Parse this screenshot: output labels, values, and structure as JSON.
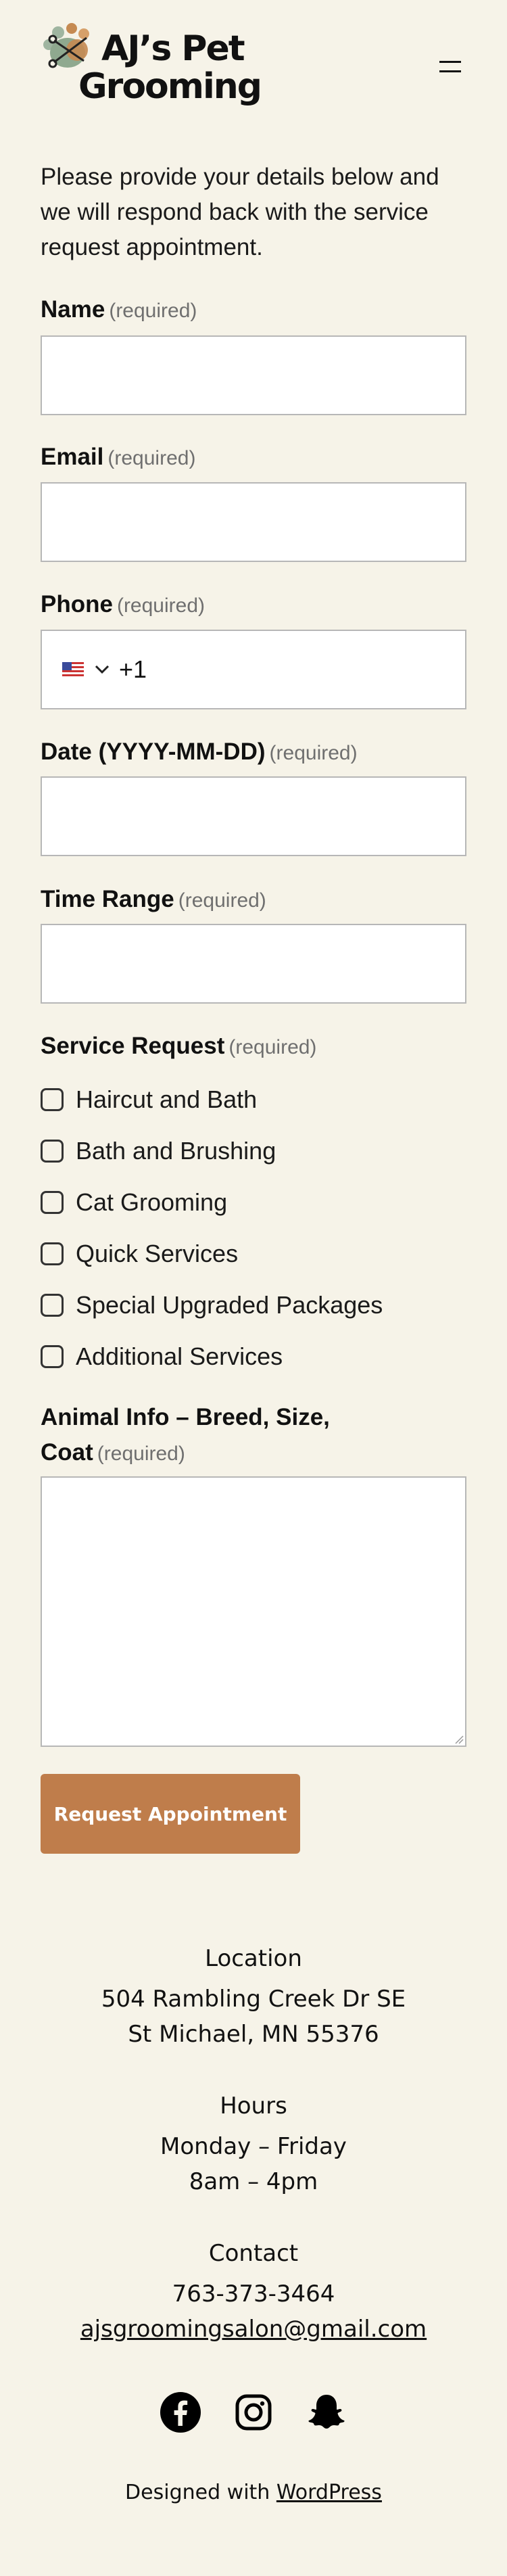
{
  "header": {
    "logo_line1": "AJ’s Pet",
    "logo_line2": "Grooming",
    "menu_icon": "hamburger-menu-icon"
  },
  "form": {
    "intro": "Please provide your details below and we will respond back with the service request appointment.",
    "required_text": "(required)",
    "name_label": "Name",
    "email_label": "Email",
    "phone_label": "Phone",
    "phone_country_flag": "us-flag-icon",
    "phone_dial_code": "+1",
    "date_label": "Date (YYYY-MM-DD)",
    "time_label": "Time Range",
    "service_label": "Service Request",
    "services": [
      "Haircut and Bath",
      "Bath and Brushing",
      "Cat Grooming",
      "Quick Services",
      "Special Upgraded Packages",
      "Additional Services"
    ],
    "animal_label_line1": "Animal Info – Breed, Size,",
    "animal_label_line2": "Coat",
    "submit_label": "Request Appointment",
    "accent_color": "#bf7d4b"
  },
  "footer": {
    "location_heading": "Location",
    "address_line1": "504 Rambling Creek Dr SE",
    "address_line2": "St Michael, MN 55376",
    "hours_heading": "Hours",
    "hours_days": "Monday – Friday",
    "hours_time": "8am – 4pm",
    "contact_heading": "Contact",
    "phone": "763-373-3464",
    "email": "ajsgroomingsalon@gmail.com",
    "social_icons": [
      "facebook-icon",
      "instagram-icon",
      "snapchat-icon"
    ],
    "credit_prefix": "Designed with ",
    "credit_link": "WordPress"
  }
}
